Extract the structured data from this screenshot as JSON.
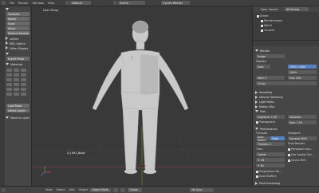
{
  "topbar": {
    "menus": [
      "File",
      "Render",
      "Window",
      "Help"
    ],
    "layout": "Default",
    "scene": "Scene",
    "engine": "Cycles Render"
  },
  "toolshelf": {
    "translate": "Translate",
    "rotate": "Rotate",
    "scale": "Scale",
    "mirror": "Mirror",
    "duplicate": "Duplicate",
    "delete": "Delete",
    "join": "Join",
    "set_origin": "Set Origin",
    "shading": "Shading:",
    "smooth": "Smooth",
    "flat": "Flat",
    "history": "History",
    "remove_doubles": "Remove Doubles",
    "panel_layers": "Layers",
    "panel_mdl_switch": "MDL Switch",
    "panel_other_shapes": "Other Shapes",
    "panel_export": "Export Props",
    "panel_materials": "Materials",
    "load_rates": "Load Rates",
    "delete_layers": "Delete Layers",
    "move_to_layer": "Move to Layer"
  },
  "viewport": {
    "view_label": "User Persp",
    "object_label": "(1) Mr2_Body"
  },
  "bottombar": {
    "view": "View",
    "select": "Select",
    "add": "Add",
    "object": "Object",
    "mode": "Object Mode",
    "global": "Global",
    "no_sync": "No Sync"
  },
  "outliner": {
    "view": "View",
    "search": "Search",
    "all_scenes": "All Scenes",
    "items": [
      "Scene",
      "RenderLayers",
      "World",
      "Camera"
    ]
  },
  "properties": {
    "panels": {
      "render": "Render",
      "dimensions": "Dimensions",
      "sampling": "Sampling",
      "volume_sampling": "Volume Sampling",
      "light_paths": "Light Paths",
      "motion_blur": "Motion Blur",
      "film": "Film",
      "performance": "Performance",
      "post_processing": "Post Processing"
    },
    "display_value": "Image",
    "feature_set": "Feature Set",
    "cpu": "CPU",
    "open_shading": "Open Shading Language",
    "threads_label": "Threads:",
    "auto_detect": "Auto-detect",
    "fixed": "Fixed",
    "threads_value": "Threads: 4",
    "tiles_label": "Tiles:",
    "center": "Center",
    "tile_x": "X: 64",
    "tile_y": "Y: 64",
    "progressive": "Progressive Re...",
    "save_buffers": "Save Buffers",
    "exposure": "Exposure: 1.00",
    "transparent": "Transparent",
    "size": "Size: 1.50",
    "gaussian": "Gaussian",
    "viewport_label": "Viewport:",
    "dynamic_bvh": "Dynamic BVH",
    "static_bvh": "Static BVH",
    "cache_bvh": "Cache BVH",
    "use_spatial": "Use Spatial Spl...",
    "final_render": "Final Render:",
    "persistent": "Persistent Ima...",
    "engine": "Cycles Render",
    "display": "Display:",
    "auto_label": "Auto",
    "resolution": "1920 x 1080",
    "percent": "100%",
    "start_frame": "Start: 1",
    "end_frame": "End: 250",
    "frame_rate": "24 fps"
  }
}
